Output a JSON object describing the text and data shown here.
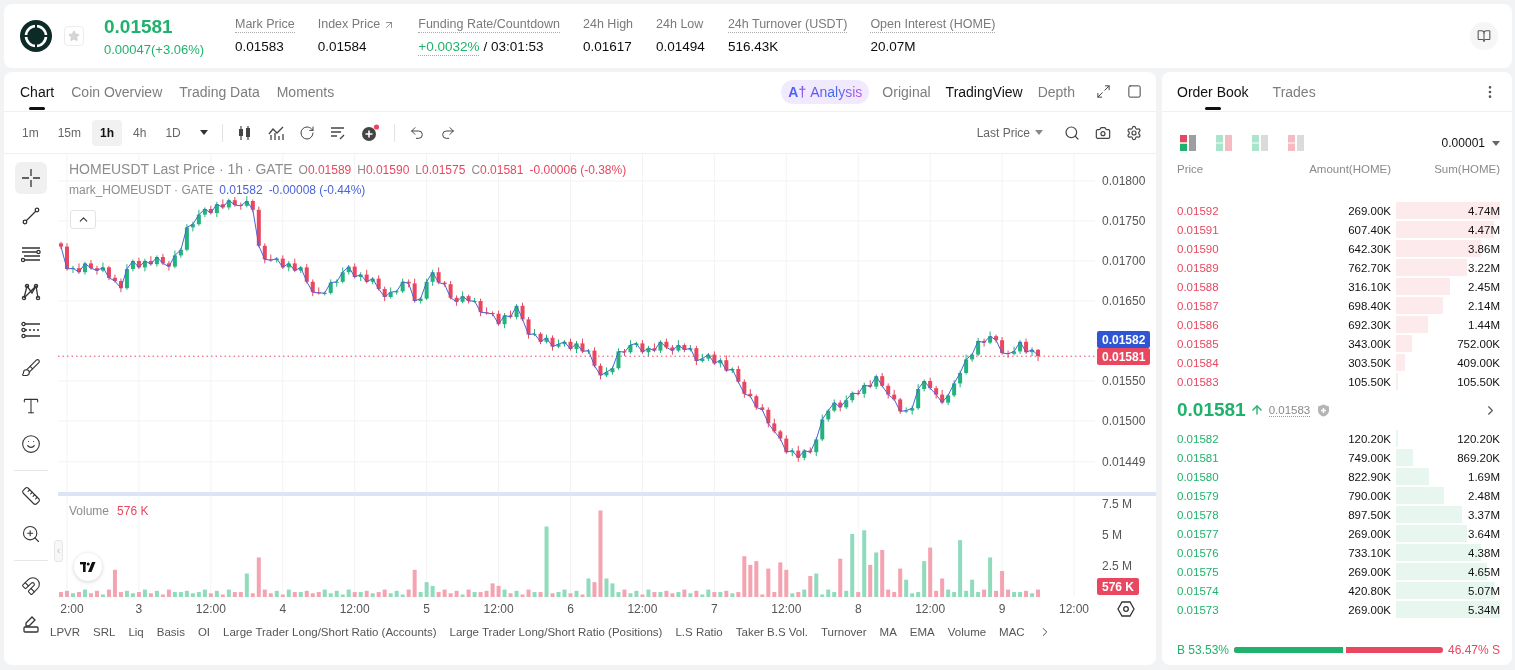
{
  "header": {
    "price": "0.01581",
    "change": "0.00047(+3.06%)",
    "favorite": false,
    "stats": [
      {
        "kind": "plain",
        "label": "Mark Price",
        "value": "0.01583",
        "tooltip": true
      },
      {
        "kind": "link",
        "label": "Index Price",
        "value": "0.01584",
        "tooltip": false
      },
      {
        "kind": "funding",
        "label": "Funding Rate/Countdown",
        "value": "+0.0032%",
        "countdown": "/ 03:01:53",
        "tooltip": true
      },
      {
        "kind": "plain",
        "label": "24h High",
        "value": "0.01617",
        "tooltip": false
      },
      {
        "kind": "plain",
        "label": "24h Low",
        "value": "0.01494",
        "tooltip": false
      },
      {
        "kind": "plain",
        "label": "24h Turnover (USDT)",
        "value": "516.43K",
        "tooltip": true
      },
      {
        "kind": "plain",
        "label": "Open Interest (HOME)",
        "value": "20.07M",
        "tooltip": true
      }
    ]
  },
  "chart_panel": {
    "tabs": [
      {
        "label": "Chart",
        "selected": true
      },
      {
        "label": "Coin Overview",
        "selected": false
      },
      {
        "label": "Trading Data",
        "selected": false
      },
      {
        "label": "Moments",
        "selected": false
      }
    ],
    "views": [
      {
        "kind": "ai",
        "badge": "A†",
        "label": "Analysis",
        "selected": false
      },
      {
        "kind": "text",
        "label": "Original",
        "selected": false
      },
      {
        "kind": "text",
        "label": "TradingView",
        "selected": true
      },
      {
        "kind": "text",
        "label": "Depth",
        "selected": false
      }
    ],
    "intervals": [
      {
        "label": "1m",
        "selected": false
      },
      {
        "label": "15m",
        "selected": false
      },
      {
        "label": "1h",
        "selected": true
      },
      {
        "label": "4h",
        "selected": false
      },
      {
        "label": "1D",
        "selected": false
      }
    ],
    "price_source": "Last Price",
    "tool_groups": [
      [
        {
          "kind": "crosshair",
          "selected": true
        },
        {
          "kind": "trend_line",
          "selected": false
        },
        {
          "kind": "parallel_lines",
          "selected": false
        },
        {
          "kind": "pattern",
          "selected": false
        },
        {
          "kind": "fib",
          "selected": false
        },
        {
          "kind": "brush",
          "selected": false
        },
        {
          "kind": "text",
          "selected": false
        },
        {
          "kind": "emoji",
          "selected": false
        }
      ],
      [
        {
          "kind": "ruler",
          "selected": false
        },
        {
          "kind": "zoom",
          "selected": false
        }
      ],
      [
        {
          "kind": "magnet",
          "selected": false
        },
        {
          "kind": "pencil",
          "selected": false
        }
      ]
    ],
    "legend": {
      "symbol": "HOMEUSDT Last Price · 1h · GATE",
      "ohlc": [
        {
          "key": "O",
          "value": "0.01589"
        },
        {
          "key": "H",
          "value": "0.01590"
        },
        {
          "key": "L",
          "value": "0.01575"
        },
        {
          "key": "C",
          "value": "0.01581"
        }
      ],
      "change": "-0.00006 (-0.38%)",
      "mark_value": "0.01582",
      "mark_change": "-0.00008 (-0.44%)"
    },
    "price_chart": {
      "chart_data": {
        "type": "candlestick",
        "categories": [
          null,
          null,
          null,
          null,
          null,
          null,
          null,
          null,
          null,
          null,
          null,
          null,
          null,
          null,
          null,
          null,
          null,
          null,
          null,
          null,
          null,
          null,
          null,
          null,
          null,
          null,
          null,
          null,
          null,
          null,
          null,
          null,
          null,
          null,
          null,
          null,
          null,
          null,
          null,
          null,
          null,
          null,
          null,
          null,
          null,
          null,
          null,
          null,
          null,
          null,
          null,
          null,
          null,
          null,
          null,
          null,
          null,
          null,
          null,
          null,
          null,
          null,
          null,
          null,
          null,
          null,
          null,
          null,
          null,
          null,
          null,
          null,
          null,
          null,
          null,
          null,
          null,
          null,
          null,
          null,
          null,
          null,
          null,
          null,
          null,
          null,
          null,
          null,
          null,
          null,
          null,
          null,
          null,
          null,
          null,
          null,
          null,
          null,
          null,
          null,
          null,
          null,
          null,
          null,
          null,
          null,
          null,
          null,
          null,
          null,
          null,
          null,
          null,
          null,
          null,
          null,
          null,
          null,
          null,
          null,
          null,
          null,
          null,
          null,
          null,
          null,
          null,
          null,
          null,
          null,
          null,
          null,
          null,
          null,
          null,
          null,
          null,
          null,
          null,
          null,
          null,
          null,
          null,
          null,
          null,
          null,
          null,
          null,
          null,
          null,
          null,
          null,
          null,
          null,
          null,
          null,
          null,
          null,
          null,
          null,
          null,
          null,
          null,
          null,
          null,
          null,
          null,
          null,
          null,
          null,
          null,
          null,
          null
        ],
        "ohlc": [
          [
            0.01722,
            0.01724,
            0.01715,
            0.01718
          ],
          [
            0.01718,
            0.01722,
            0.01688,
            0.0169
          ],
          [
            0.0169,
            0.01694,
            0.01685,
            0.01691
          ],
          [
            0.01691,
            0.01697,
            0.01684,
            0.01686
          ],
          [
            0.01686,
            0.01699,
            0.01683,
            0.01697
          ],
          [
            0.01697,
            0.01701,
            0.01689,
            0.01691
          ],
          [
            0.01691,
            0.01694,
            0.01683,
            0.01688
          ],
          [
            0.01688,
            0.01698,
            0.01686,
            0.01692
          ],
          [
            0.01692,
            0.01694,
            0.01676,
            0.01679
          ],
          [
            0.01679,
            0.01683,
            0.01673,
            0.01675
          ],
          [
            0.01675,
            0.01678,
            0.01661,
            0.01666
          ],
          [
            0.01666,
            0.01696,
            0.01664,
            0.0169
          ],
          [
            0.0169,
            0.01702,
            0.01687,
            0.017
          ],
          [
            0.017,
            0.01704,
            0.0169,
            0.01692
          ],
          [
            0.01692,
            0.01703,
            0.01687,
            0.017
          ],
          [
            0.017,
            0.01706,
            0.01694,
            0.01696
          ],
          [
            0.01696,
            0.01707,
            0.01693,
            0.01705
          ],
          [
            0.01705,
            0.01709,
            0.01695,
            0.01697
          ],
          [
            0.01697,
            0.017,
            0.01688,
            0.01693
          ],
          [
            0.01693,
            0.01713,
            0.01691,
            0.01707
          ],
          [
            0.01707,
            0.01716,
            0.01704,
            0.01714
          ],
          [
            0.01714,
            0.01746,
            0.01712,
            0.01742
          ],
          [
            0.01742,
            0.01749,
            0.01737,
            0.01746
          ],
          [
            0.01746,
            0.01764,
            0.01744,
            0.01758
          ],
          [
            0.01758,
            0.01767,
            0.01755,
            0.01765
          ],
          [
            0.01765,
            0.01769,
            0.01758,
            0.0176
          ],
          [
            0.0176,
            0.01774,
            0.01755,
            0.01771
          ],
          [
            0.01771,
            0.01777,
            0.01765,
            0.01767
          ],
          [
            0.01767,
            0.01778,
            0.01764,
            0.01776
          ],
          [
            0.01776,
            0.0178,
            0.01768,
            0.0177
          ],
          [
            0.0177,
            0.01773,
            0.01764,
            0.01769
          ],
          [
            0.01769,
            0.01781,
            0.01767,
            0.01775
          ],
          [
            0.01775,
            0.01777,
            0.01761,
            0.01764
          ],
          [
            0.01764,
            0.01768,
            0.01717,
            0.01719
          ],
          [
            0.01719,
            0.01722,
            0.01697,
            0.01702
          ],
          [
            0.01702,
            0.01708,
            0.01699,
            0.01701
          ],
          [
            0.01701,
            0.01705,
            0.01698,
            0.01703
          ],
          [
            0.01703,
            0.01707,
            0.0169,
            0.01692
          ],
          [
            0.01692,
            0.017,
            0.01687,
            0.01697
          ],
          [
            0.01697,
            0.01703,
            0.01686,
            0.01688
          ],
          [
            0.01688,
            0.01694,
            0.01685,
            0.01692
          ],
          [
            0.01692,
            0.01696,
            0.01672,
            0.01674
          ],
          [
            0.01674,
            0.01677,
            0.01656,
            0.01661
          ],
          [
            0.01661,
            0.01667,
            0.01658,
            0.0166
          ],
          [
            0.0166,
            0.01662,
            0.01657,
            0.0166
          ],
          [
            0.0166,
            0.01677,
            0.01658,
            0.01673
          ],
          [
            0.01673,
            0.01677,
            0.01668,
            0.01674
          ],
          [
            0.01674,
            0.01692,
            0.01672,
            0.01686
          ],
          [
            0.01686,
            0.01695,
            0.01683,
            0.01693
          ],
          [
            0.01693,
            0.01697,
            0.01678,
            0.0168
          ],
          [
            0.0168,
            0.01686,
            0.01675,
            0.01683
          ],
          [
            0.01683,
            0.01689,
            0.01672,
            0.01674
          ],
          [
            0.01674,
            0.0168,
            0.01671,
            0.01678
          ],
          [
            0.01678,
            0.01682,
            0.01663,
            0.01665
          ],
          [
            0.01665,
            0.01668,
            0.0165,
            0.01655
          ],
          [
            0.01655,
            0.01667,
            0.01653,
            0.01661
          ],
          [
            0.01661,
            0.01664,
            0.01658,
            0.01662
          ],
          [
            0.01662,
            0.01678,
            0.0166,
            0.01674
          ],
          [
            0.01674,
            0.01677,
            0.01667,
            0.01672
          ],
          [
            0.01672,
            0.01678,
            0.01648,
            0.0165
          ],
          [
            0.0165,
            0.01655,
            0.01647,
            0.01653
          ],
          [
            0.01653,
            0.01678,
            0.01651,
            0.01674
          ],
          [
            0.01674,
            0.01689,
            0.01669,
            0.01686
          ],
          [
            0.01686,
            0.01692,
            0.01671,
            0.01673
          ],
          [
            0.01673,
            0.01675,
            0.01668,
            0.01671
          ],
          [
            0.01671,
            0.01675,
            0.01652,
            0.01654
          ],
          [
            0.01654,
            0.01657,
            0.01644,
            0.01649
          ],
          [
            0.01649,
            0.01662,
            0.01647,
            0.01656
          ],
          [
            0.01656,
            0.01658,
            0.01647,
            0.0165
          ],
          [
            0.0165,
            0.01654,
            0.01648,
            0.0165
          ],
          [
            0.0165,
            0.01653,
            0.01631,
            0.01636
          ],
          [
            0.01636,
            0.01642,
            0.01633,
            0.01635
          ],
          [
            0.01635,
            0.01637,
            0.01631,
            0.01634
          ],
          [
            0.01634,
            0.01638,
            0.01619,
            0.01621
          ],
          [
            0.01621,
            0.01635,
            0.01616,
            0.01632
          ],
          [
            0.01632,
            0.01638,
            0.01628,
            0.0163
          ],
          [
            0.0163,
            0.01646,
            0.01627,
            0.01644
          ],
          [
            0.01644,
            0.01648,
            0.01625,
            0.01627
          ],
          [
            0.01627,
            0.0163,
            0.01603,
            0.01608
          ],
          [
            0.01608,
            0.01615,
            0.01606,
            0.01609
          ],
          [
            0.01609,
            0.01611,
            0.01596,
            0.01599
          ],
          [
            0.01599,
            0.01608,
            0.01597,
            0.01604
          ],
          [
            0.01604,
            0.01607,
            0.01588,
            0.01593
          ],
          [
            0.01593,
            0.01602,
            0.01591,
            0.01596
          ],
          [
            0.01596,
            0.01601,
            0.01593,
            0.01599
          ],
          [
            0.01599,
            0.01603,
            0.01588,
            0.0159
          ],
          [
            0.0159,
            0.016,
            0.01585,
            0.01597
          ],
          [
            0.01597,
            0.01603,
            0.01585,
            0.01587
          ],
          [
            0.01587,
            0.0159,
            0.01584,
            0.01588
          ],
          [
            0.01588,
            0.01592,
            0.01567,
            0.01569
          ],
          [
            0.01569,
            0.01572,
            0.01552,
            0.01557
          ],
          [
            0.01557,
            0.01567,
            0.01555,
            0.01561
          ],
          [
            0.01561,
            0.01568,
            0.01558,
            0.01566
          ],
          [
            0.01566,
            0.01591,
            0.01564,
            0.01587
          ],
          [
            0.01587,
            0.0159,
            0.01581,
            0.01586
          ],
          [
            0.01586,
            0.01601,
            0.01584,
            0.01595
          ],
          [
            0.01595,
            0.01599,
            0.01592,
            0.01597
          ],
          [
            0.01597,
            0.01601,
            0.01584,
            0.01586
          ],
          [
            0.01586,
            0.01594,
            0.01581,
            0.01591
          ],
          [
            0.01591,
            0.01597,
            0.01586,
            0.01588
          ],
          [
            0.01588,
            0.01601,
            0.01585,
            0.01599
          ],
          [
            0.01599,
            0.01603,
            0.0159,
            0.01592
          ],
          [
            0.01592,
            0.01595,
            0.01583,
            0.01588
          ],
          [
            0.01588,
            0.01601,
            0.01586,
            0.01595
          ],
          [
            0.01595,
            0.01597,
            0.01586,
            0.01589
          ],
          [
            0.01589,
            0.01595,
            0.01587,
            0.01591
          ],
          [
            0.01591,
            0.01594,
            0.0157,
            0.01575
          ],
          [
            0.01575,
            0.01584,
            0.01573,
            0.01578
          ],
          [
            0.01578,
            0.01585,
            0.01575,
            0.01583
          ],
          [
            0.01583,
            0.01587,
            0.0157,
            0.01572
          ],
          [
            0.01572,
            0.01579,
            0.01567,
            0.01576
          ],
          [
            0.01576,
            0.01582,
            0.01561,
            0.01563
          ],
          [
            0.01563,
            0.01567,
            0.0156,
            0.01565
          ],
          [
            0.01565,
            0.01569,
            0.01547,
            0.01549
          ],
          [
            0.01549,
            0.01552,
            0.01529,
            0.01534
          ],
          [
            0.01534,
            0.0154,
            0.01529,
            0.01531
          ],
          [
            0.01531,
            0.01533,
            0.01514,
            0.01517
          ],
          [
            0.01517,
            0.01521,
            0.01512,
            0.01514
          ],
          [
            0.01514,
            0.01517,
            0.01492,
            0.01497
          ],
          [
            0.01497,
            0.01503,
            0.01485,
            0.01487
          ],
          [
            0.01487,
            0.01489,
            0.01475,
            0.01478
          ],
          [
            0.01478,
            0.01482,
            0.01459,
            0.01461
          ],
          [
            0.01461,
            0.01466,
            0.01456,
            0.01463
          ],
          [
            0.01463,
            0.01469,
            0.01449,
            0.01454
          ],
          [
            0.01454,
            0.01465,
            0.01451,
            0.01463
          ],
          [
            0.01463,
            0.01467,
            0.01459,
            0.01461
          ],
          [
            0.01461,
            0.0148,
            0.01456,
            0.01477
          ],
          [
            0.01477,
            0.01508,
            0.01475,
            0.01502
          ],
          [
            0.01502,
            0.01515,
            0.01499,
            0.01513
          ],
          [
            0.01513,
            0.01527,
            0.01511,
            0.01523
          ],
          [
            0.01523,
            0.01526,
            0.01512,
            0.01517
          ],
          [
            0.01517,
            0.01532,
            0.01515,
            0.01526
          ],
          [
            0.01526,
            0.01537,
            0.01523,
            0.01535
          ],
          [
            0.01535,
            0.01539,
            0.01532,
            0.01534
          ],
          [
            0.01534,
            0.01548,
            0.01529,
            0.01545
          ],
          [
            0.01545,
            0.01551,
            0.01541,
            0.01543
          ],
          [
            0.01543,
            0.01558,
            0.0154,
            0.01556
          ],
          [
            0.01556,
            0.0156,
            0.01542,
            0.01544
          ],
          [
            0.01544,
            0.01547,
            0.01528,
            0.01533
          ],
          [
            0.01533,
            0.01539,
            0.01525,
            0.01527
          ],
          [
            0.01527,
            0.01529,
            0.01509,
            0.01512
          ],
          [
            0.01512,
            0.01517,
            0.0151,
            0.01513
          ],
          [
            0.01513,
            0.01519,
            0.01508,
            0.01516
          ],
          [
            0.01516,
            0.01546,
            0.01514,
            0.0154
          ],
          [
            0.0154,
            0.01552,
            0.01537,
            0.0155
          ],
          [
            0.0155,
            0.01554,
            0.01539,
            0.01541
          ],
          [
            0.01541,
            0.01544,
            0.01528,
            0.01533
          ],
          [
            0.01533,
            0.01539,
            0.01521,
            0.01523
          ],
          [
            0.01523,
            0.01534,
            0.0152,
            0.01532
          ],
          [
            0.01532,
            0.01551,
            0.0153,
            0.01547
          ],
          [
            0.01547,
            0.01563,
            0.01542,
            0.0156
          ],
          [
            0.0156,
            0.01583,
            0.01558,
            0.01577
          ],
          [
            0.01577,
            0.01585,
            0.01574,
            0.01583
          ],
          [
            0.01583,
            0.01604,
            0.01581,
            0.016
          ],
          [
            0.016,
            0.01603,
            0.01593,
            0.01598
          ],
          [
            0.01598,
            0.01612,
            0.01596,
            0.01606
          ],
          [
            0.01606,
            0.01608,
            0.01598,
            0.01601
          ],
          [
            0.01601,
            0.01605,
            0.01583,
            0.01585
          ],
          [
            0.01585,
            0.01588,
            0.01579,
            0.01584
          ],
          [
            0.01584,
            0.01593,
            0.01582,
            0.01587
          ],
          [
            0.01587,
            0.01601,
            0.01584,
            0.01599
          ],
          [
            0.01599,
            0.01603,
            0.01584,
            0.01586
          ],
          [
            0.01586,
            0.01592,
            0.01581,
            0.01589
          ],
          [
            0.01589,
            0.0159,
            0.01575,
            0.01581
          ],
          null,
          null,
          null,
          null,
          null,
          null,
          null,
          null,
          null
        ],
        "series": [
          {
            "name": "mark_HOMEUSDT · GATE",
            "type": "line",
            "color": "#4a63d8",
            "values": [
              0.01718,
              0.0169,
              0.01691,
              0.01686,
              0.01697,
              0.01691,
              0.01688,
              0.01692,
              0.01679,
              0.01675,
              0.01666,
              0.0169,
              0.017,
              0.01692,
              0.017,
              0.01696,
              0.01705,
              0.01697,
              0.01693,
              0.01707,
              0.01714,
              0.01742,
              0.01746,
              0.01758,
              0.01765,
              0.0176,
              0.01771,
              0.01767,
              0.01776,
              0.0177,
              0.01769,
              0.01775,
              0.01764,
              0.01719,
              0.01702,
              0.01701,
              0.01703,
              0.01692,
              0.01697,
              0.01688,
              0.01692,
              0.01674,
              0.01661,
              0.0166,
              0.0166,
              0.01673,
              0.01674,
              0.01686,
              0.01693,
              0.0168,
              0.01683,
              0.01674,
              0.01678,
              0.01665,
              0.01655,
              0.01661,
              0.01662,
              0.01674,
              0.01672,
              0.0165,
              0.01653,
              0.01674,
              0.01686,
              0.01673,
              0.01671,
              0.01654,
              0.01649,
              0.01656,
              0.0165,
              0.0165,
              0.01636,
              0.01635,
              0.01634,
              0.01621,
              0.01632,
              0.0163,
              0.01644,
              0.01627,
              0.01608,
              0.01609,
              0.01599,
              0.01604,
              0.01593,
              0.01596,
              0.01599,
              0.0159,
              0.01597,
              0.01587,
              0.01588,
              0.01569,
              0.01557,
              0.01561,
              0.01566,
              0.01587,
              0.01586,
              0.01595,
              0.01597,
              0.01586,
              0.01591,
              0.01588,
              0.01599,
              0.01592,
              0.01588,
              0.01595,
              0.01589,
              0.01591,
              0.01575,
              0.01578,
              0.01583,
              0.01572,
              0.01576,
              0.01563,
              0.01565,
              0.01549,
              0.01534,
              0.01531,
              0.01517,
              0.01514,
              0.01497,
              0.01487,
              0.01478,
              0.01461,
              0.01463,
              0.01454,
              0.01463,
              0.01461,
              0.01477,
              0.01502,
              0.01513,
              0.01523,
              0.01517,
              0.01526,
              0.01535,
              0.01534,
              0.01545,
              0.01543,
              0.01556,
              0.01544,
              0.01533,
              0.01527,
              0.01512,
              0.01513,
              0.01516,
              0.0154,
              0.0155,
              0.01541,
              0.01533,
              0.01523,
              0.01532,
              0.01547,
              0.0156,
              0.01577,
              0.01583,
              0.016,
              0.01598,
              0.01606,
              0.01601,
              0.01585,
              0.01584,
              0.01587,
              0.01599,
              0.01586,
              0.01589,
              0.01582,
              null,
              null,
              null,
              null,
              null,
              null,
              null,
              null,
              null
            ]
          }
        ],
        "ylim": [
          0.0141125,
          0.0183375
        ],
        "yticks": [
          {
            "value": 0.018,
            "label": "0.01800"
          },
          {
            "value": 0.0175,
            "label": "0.01750"
          },
          {
            "value": 0.017,
            "label": "0.01700"
          },
          {
            "value": 0.0165,
            "label": "0.01650"
          },
          {
            "value": 0.0155,
            "label": "0.01550"
          },
          {
            "value": 0.015,
            "label": "0.01500"
          },
          {
            "value": 0.01449,
            "label": "0.01449"
          }
        ],
        "ref_lines": [
          {
            "axis": "y",
            "value": 0.01581
          }
        ],
        "grid": true
      }
    },
    "price_tags": [
      {
        "value": "0.01582",
        "color": "#2f55d4"
      },
      {
        "value": "0.01581",
        "color": "#e8475f"
      }
    ],
    "volume": {
      "value": "576 K",
      "tag": "576 K",
      "chart_data": {
        "type": "bar",
        "categories": [
          null,
          "2:00",
          null,
          null,
          null,
          null,
          null,
          null,
          null,
          null,
          null,
          null,
          null,
          "3",
          null,
          null,
          null,
          null,
          null,
          null,
          null,
          null,
          null,
          null,
          null,
          "12:00",
          null,
          null,
          null,
          null,
          null,
          null,
          null,
          null,
          null,
          null,
          null,
          "4",
          null,
          null,
          null,
          null,
          null,
          null,
          null,
          null,
          null,
          null,
          null,
          "12:00",
          null,
          null,
          null,
          null,
          null,
          null,
          null,
          null,
          null,
          null,
          null,
          "5",
          null,
          null,
          null,
          null,
          null,
          null,
          null,
          null,
          null,
          null,
          null,
          "12:00",
          null,
          null,
          null,
          null,
          null,
          null,
          null,
          null,
          null,
          null,
          null,
          "6",
          null,
          null,
          null,
          null,
          null,
          null,
          null,
          null,
          null,
          null,
          null,
          "12:00",
          null,
          null,
          null,
          null,
          null,
          null,
          null,
          null,
          null,
          null,
          null,
          "7",
          null,
          null,
          null,
          null,
          null,
          null,
          null,
          null,
          null,
          null,
          null,
          "12:00",
          null,
          null,
          null,
          null,
          null,
          null,
          null,
          null,
          null,
          null,
          null,
          "8",
          null,
          null,
          null,
          null,
          null,
          null,
          null,
          null,
          null,
          null,
          null,
          "12:00",
          null,
          null,
          null,
          null,
          null,
          null,
          null,
          null,
          null,
          null,
          null,
          "9",
          null,
          null,
          null,
          null,
          null,
          null,
          null,
          null,
          null,
          null,
          null,
          "12:00",
          null,
          null,
          null
        ],
        "series": [
          {
            "name": "Volume",
            "values": [
              0.4,
              0.5,
              0.3,
              0.4,
              0.6,
              0.3,
              0.5,
              0.2,
              0.6,
              2.2,
              0.4,
              0.5,
              0.3,
              0.4,
              0.6,
              0.3,
              0.5,
              0.2,
              0.6,
              0.4,
              0.4,
              0.5,
              0.3,
              0.4,
              0.6,
              0.3,
              0.5,
              0.2,
              0.6,
              0.4,
              0.4,
              1.9,
              0.3,
              3.2,
              0.6,
              0.3,
              0.5,
              0.2,
              0.6,
              0.4,
              0.4,
              0.5,
              0.3,
              0.4,
              0.6,
              0.3,
              0.5,
              0.2,
              0.6,
              0.4,
              0.4,
              0.5,
              0.3,
              0.4,
              0.6,
              0.3,
              0.5,
              0.2,
              0.6,
              2.2,
              0.4,
              1.2,
              0.9,
              0.4,
              0.6,
              0.3,
              0.5,
              0.2,
              0.6,
              0.4,
              0.4,
              0.5,
              1.1,
              0.9,
              0.6,
              0.3,
              0.5,
              0.2,
              0.6,
              0.4,
              0.4,
              5.7,
              0.3,
              0.4,
              0.6,
              0.3,
              0.5,
              0.2,
              1.5,
              1.2,
              7.0,
              1.5,
              1.1,
              0.4,
              0.6,
              0.3,
              0.5,
              0.2,
              0.6,
              0.4,
              0.4,
              0.5,
              0.3,
              0.4,
              0.6,
              0.3,
              0.5,
              0.2,
              0.6,
              0.4,
              0.4,
              0.5,
              0.3,
              0.4,
              3.3,
              2.6,
              2.9,
              0.2,
              2.3,
              0.4,
              2.8,
              2.2,
              0.3,
              0.4,
              0.6,
              1.7,
              1.9,
              0.2,
              0.6,
              0.4,
              3.1,
              0.5,
              5.1,
              0.4,
              5.4,
              2.6,
              3.6,
              3.8,
              0.6,
              0.4,
              2.3,
              1.4,
              0.3,
              0.4,
              2.9,
              4.0,
              0.5,
              1.5,
              0.6,
              0.4,
              4.6,
              0.5,
              1.4,
              0.4,
              0.6,
              3.2,
              0.5,
              2.1,
              0.6,
              0.4,
              0.4,
              0.5,
              0.3,
              0.6,
              null,
              null,
              null,
              null,
              null,
              null,
              null,
              null,
              null
            ]
          }
        ],
        "ylim": [
          0,
          8.17
        ],
        "yticks": [
          {
            "value": 2.5,
            "label": "2.5 M"
          },
          {
            "value": 5,
            "label": "5 M"
          },
          {
            "value": 7.5,
            "label": "7.5 M"
          }
        ],
        "grid": true
      }
    },
    "indicators": [
      "LPVR",
      "SRL",
      "Liq",
      "Basis",
      "OI",
      "Large Trader Long/Short Ratio (Accounts)",
      "Large Trader Long/Short Ratio (Positions)",
      "L.S Ratio",
      "Taker B.S Vol.",
      "Turnover",
      "MA",
      "EMA",
      "Volume",
      "MAC"
    ]
  },
  "order_book": {
    "tabs": [
      {
        "label": "Order Book",
        "selected": true
      },
      {
        "label": "Trades",
        "selected": false
      }
    ],
    "depth_modes": [
      {
        "kind": "both",
        "selected": true
      },
      {
        "kind": "split",
        "selected": false
      },
      {
        "kind": "bids",
        "selected": false
      },
      {
        "kind": "asks",
        "selected": false
      }
    ],
    "precision": "0.00001",
    "columns": [
      "Price",
      "Amount(HOME)",
      "Sum(HOME)"
    ],
    "asks": [
      {
        "price": "0.01592",
        "amount": "269.00K",
        "sum": "4.74M"
      },
      {
        "price": "0.01591",
        "amount": "607.40K",
        "sum": "4.47M"
      },
      {
        "price": "0.01590",
        "amount": "642.30K",
        "sum": "3.86M"
      },
      {
        "price": "0.01589",
        "amount": "762.70K",
        "sum": "3.22M"
      },
      {
        "price": "0.01588",
        "amount": "316.10K",
        "sum": "2.45M"
      },
      {
        "price": "0.01587",
        "amount": "698.40K",
        "sum": "2.14M"
      },
      {
        "price": "0.01586",
        "amount": "692.30K",
        "sum": "1.44M"
      },
      {
        "price": "0.01585",
        "amount": "343.00K",
        "sum": "752.00K"
      },
      {
        "price": "0.01584",
        "amount": "303.50K",
        "sum": "409.00K"
      },
      {
        "price": "0.01583",
        "amount": "105.50K",
        "sum": "105.50K"
      }
    ],
    "last": {
      "price": "0.01581",
      "rising": true,
      "mark": "0.01583"
    },
    "bids": [
      {
        "price": "0.01582",
        "amount": "120.20K",
        "sum": "120.20K"
      },
      {
        "price": "0.01581",
        "amount": "749.00K",
        "sum": "869.20K"
      },
      {
        "price": "0.01580",
        "amount": "822.90K",
        "sum": "1.69M"
      },
      {
        "price": "0.01579",
        "amount": "790.00K",
        "sum": "2.48M"
      },
      {
        "price": "0.01578",
        "amount": "897.50K",
        "sum": "3.37M"
      },
      {
        "price": "0.01577",
        "amount": "269.00K",
        "sum": "3.64M"
      },
      {
        "price": "0.01576",
        "amount": "733.10K",
        "sum": "4.38M"
      },
      {
        "price": "0.01575",
        "amount": "269.00K",
        "sum": "4.65M"
      },
      {
        "price": "0.01574",
        "amount": "420.80K",
        "sum": "5.07M"
      },
      {
        "price": "0.01573",
        "amount": "269.00K",
        "sum": "5.34M"
      }
    ],
    "ratio": {
      "buy_label": "B",
      "buy": "53.53%",
      "sell": "46.47%",
      "sell_label": "S",
      "level": 0.5353
    }
  }
}
